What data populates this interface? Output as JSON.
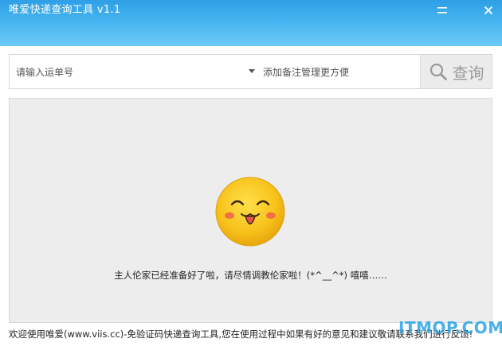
{
  "window": {
    "title": "唯爱快递查询工具 v1.1",
    "minimize_icon": "minimize-icon",
    "close_icon": "close-icon"
  },
  "search": {
    "tracking_placeholder": "请输入运单号",
    "tracking_value": "",
    "remark_placeholder": "添加备注管理更方便",
    "remark_value": "",
    "dropdown_icon": "dropdown-arrow-icon",
    "query_icon": "search-icon",
    "query_label": "查询"
  },
  "content": {
    "emoji_icon": "smiley-face-icon",
    "message": "主人伦家已经准备好了啦，请尽情调教伦家啦！(*^__^*) 嘻嘻……"
  },
  "footer": {
    "text": "欢迎使用唯爱(www.viis.cc)-免验证码快递查询工具,您在使用过程中如果有好的意见和建议敬请联系我们进行反馈!"
  },
  "watermark": {
    "text": "ITMOP.COM"
  },
  "colors": {
    "titlebar_top": "#2f9fe6",
    "titlebar_bottom": "#6ccaf7",
    "panel_bg": "#ededed",
    "smiley_yellow": "#f7c21a",
    "watermark": "#2aa4e6"
  }
}
